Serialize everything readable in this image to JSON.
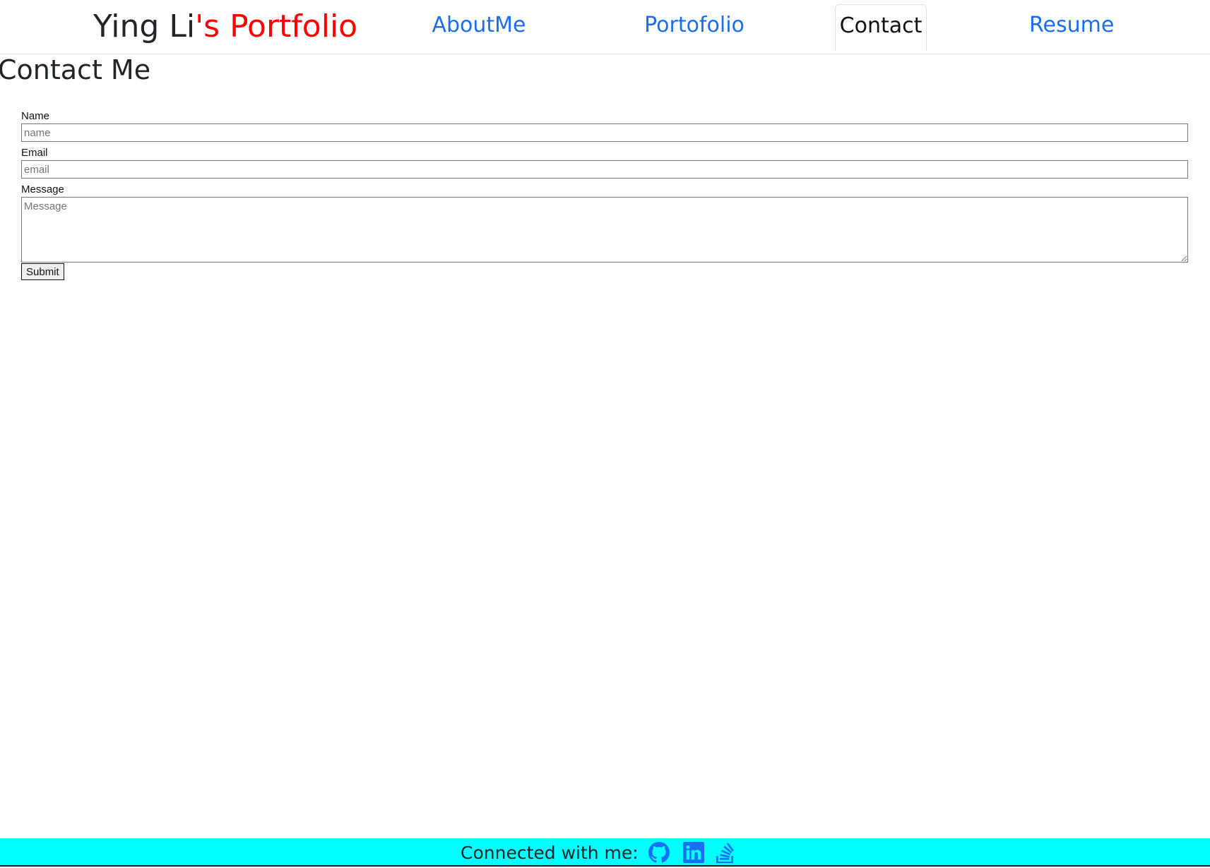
{
  "header": {
    "brand_name": "Ying Li",
    "brand_accent": "'s Portfolio",
    "tabs": [
      {
        "label": "AboutMe",
        "active": false
      },
      {
        "label": "Portofolio",
        "active": false
      },
      {
        "label": "Contact",
        "active": true
      },
      {
        "label": "Resume",
        "active": false
      }
    ]
  },
  "main": {
    "title": "Contact Me",
    "form": {
      "name_label": "Name",
      "name_placeholder": "name",
      "email_label": "Email",
      "email_placeholder": "email",
      "message_label": "Message",
      "message_placeholder": "Message",
      "submit_label": "Submit"
    }
  },
  "footer": {
    "text": "Connected with me:",
    "icons": [
      "github-icon",
      "linkedin-icon",
      "stackoverflow-icon"
    ]
  },
  "colors": {
    "nav_link": "#1b6ef3",
    "brand_accent": "#ff0000",
    "footer_bg": "#00ffff",
    "icon": "#1b6ef3"
  }
}
